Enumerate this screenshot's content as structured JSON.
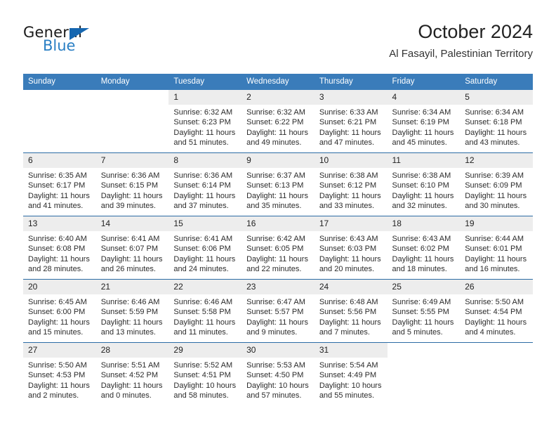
{
  "brand": {
    "name_top": "General",
    "name_bottom": "Blue",
    "triangle_icon": "brand-triangle-icon",
    "accent_color": "#1667b0",
    "blue_text_color": "#2a7fc4"
  },
  "header": {
    "title": "October 2024",
    "subtitle": "Al Fasayil, Palestinian Territory"
  },
  "theme": {
    "header_bg": "#3a7cba",
    "header_text": "#ffffff",
    "daynum_bg": "#ededed",
    "row_divider": "#2c6ca5",
    "cell_bg": "#ffffff",
    "body_text": "#2b2b2b"
  },
  "weekdays": [
    "Sunday",
    "Monday",
    "Tuesday",
    "Wednesday",
    "Thursday",
    "Friday",
    "Saturday"
  ],
  "labels": {
    "sunrise_prefix": "Sunrise:",
    "sunset_prefix": "Sunset:",
    "daylight_prefix": "Daylight:"
  },
  "weeks": [
    [
      {
        "day": "",
        "blank": true,
        "line1": "",
        "line2": "",
        "line3": "",
        "line4": ""
      },
      {
        "day": "",
        "blank": true,
        "line1": "",
        "line2": "",
        "line3": "",
        "line4": ""
      },
      {
        "day": "1",
        "line1": "Sunrise: 6:32 AM",
        "line2": "Sunset: 6:23 PM",
        "line3": "Daylight: 11 hours",
        "line4": "and 51 minutes."
      },
      {
        "day": "2",
        "line1": "Sunrise: 6:32 AM",
        "line2": "Sunset: 6:22 PM",
        "line3": "Daylight: 11 hours",
        "line4": "and 49 minutes."
      },
      {
        "day": "3",
        "line1": "Sunrise: 6:33 AM",
        "line2": "Sunset: 6:21 PM",
        "line3": "Daylight: 11 hours",
        "line4": "and 47 minutes."
      },
      {
        "day": "4",
        "line1": "Sunrise: 6:34 AM",
        "line2": "Sunset: 6:19 PM",
        "line3": "Daylight: 11 hours",
        "line4": "and 45 minutes."
      },
      {
        "day": "5",
        "line1": "Sunrise: 6:34 AM",
        "line2": "Sunset: 6:18 PM",
        "line3": "Daylight: 11 hours",
        "line4": "and 43 minutes."
      }
    ],
    [
      {
        "day": "6",
        "line1": "Sunrise: 6:35 AM",
        "line2": "Sunset: 6:17 PM",
        "line3": "Daylight: 11 hours",
        "line4": "and 41 minutes."
      },
      {
        "day": "7",
        "line1": "Sunrise: 6:36 AM",
        "line2": "Sunset: 6:15 PM",
        "line3": "Daylight: 11 hours",
        "line4": "and 39 minutes."
      },
      {
        "day": "8",
        "line1": "Sunrise: 6:36 AM",
        "line2": "Sunset: 6:14 PM",
        "line3": "Daylight: 11 hours",
        "line4": "and 37 minutes."
      },
      {
        "day": "9",
        "line1": "Sunrise: 6:37 AM",
        "line2": "Sunset: 6:13 PM",
        "line3": "Daylight: 11 hours",
        "line4": "and 35 minutes."
      },
      {
        "day": "10",
        "line1": "Sunrise: 6:38 AM",
        "line2": "Sunset: 6:12 PM",
        "line3": "Daylight: 11 hours",
        "line4": "and 33 minutes."
      },
      {
        "day": "11",
        "line1": "Sunrise: 6:38 AM",
        "line2": "Sunset: 6:10 PM",
        "line3": "Daylight: 11 hours",
        "line4": "and 32 minutes."
      },
      {
        "day": "12",
        "line1": "Sunrise: 6:39 AM",
        "line2": "Sunset: 6:09 PM",
        "line3": "Daylight: 11 hours",
        "line4": "and 30 minutes."
      }
    ],
    [
      {
        "day": "13",
        "line1": "Sunrise: 6:40 AM",
        "line2": "Sunset: 6:08 PM",
        "line3": "Daylight: 11 hours",
        "line4": "and 28 minutes."
      },
      {
        "day": "14",
        "line1": "Sunrise: 6:41 AM",
        "line2": "Sunset: 6:07 PM",
        "line3": "Daylight: 11 hours",
        "line4": "and 26 minutes."
      },
      {
        "day": "15",
        "line1": "Sunrise: 6:41 AM",
        "line2": "Sunset: 6:06 PM",
        "line3": "Daylight: 11 hours",
        "line4": "and 24 minutes."
      },
      {
        "day": "16",
        "line1": "Sunrise: 6:42 AM",
        "line2": "Sunset: 6:05 PM",
        "line3": "Daylight: 11 hours",
        "line4": "and 22 minutes."
      },
      {
        "day": "17",
        "line1": "Sunrise: 6:43 AM",
        "line2": "Sunset: 6:03 PM",
        "line3": "Daylight: 11 hours",
        "line4": "and 20 minutes."
      },
      {
        "day": "18",
        "line1": "Sunrise: 6:43 AM",
        "line2": "Sunset: 6:02 PM",
        "line3": "Daylight: 11 hours",
        "line4": "and 18 minutes."
      },
      {
        "day": "19",
        "line1": "Sunrise: 6:44 AM",
        "line2": "Sunset: 6:01 PM",
        "line3": "Daylight: 11 hours",
        "line4": "and 16 minutes."
      }
    ],
    [
      {
        "day": "20",
        "line1": "Sunrise: 6:45 AM",
        "line2": "Sunset: 6:00 PM",
        "line3": "Daylight: 11 hours",
        "line4": "and 15 minutes."
      },
      {
        "day": "21",
        "line1": "Sunrise: 6:46 AM",
        "line2": "Sunset: 5:59 PM",
        "line3": "Daylight: 11 hours",
        "line4": "and 13 minutes."
      },
      {
        "day": "22",
        "line1": "Sunrise: 6:46 AM",
        "line2": "Sunset: 5:58 PM",
        "line3": "Daylight: 11 hours",
        "line4": "and 11 minutes."
      },
      {
        "day": "23",
        "line1": "Sunrise: 6:47 AM",
        "line2": "Sunset: 5:57 PM",
        "line3": "Daylight: 11 hours",
        "line4": "and 9 minutes."
      },
      {
        "day": "24",
        "line1": "Sunrise: 6:48 AM",
        "line2": "Sunset: 5:56 PM",
        "line3": "Daylight: 11 hours",
        "line4": "and 7 minutes."
      },
      {
        "day": "25",
        "line1": "Sunrise: 6:49 AM",
        "line2": "Sunset: 5:55 PM",
        "line3": "Daylight: 11 hours",
        "line4": "and 5 minutes."
      },
      {
        "day": "26",
        "line1": "Sunrise: 5:50 AM",
        "line2": "Sunset: 4:54 PM",
        "line3": "Daylight: 11 hours",
        "line4": "and 4 minutes."
      }
    ],
    [
      {
        "day": "27",
        "line1": "Sunrise: 5:50 AM",
        "line2": "Sunset: 4:53 PM",
        "line3": "Daylight: 11 hours",
        "line4": "and 2 minutes."
      },
      {
        "day": "28",
        "line1": "Sunrise: 5:51 AM",
        "line2": "Sunset: 4:52 PM",
        "line3": "Daylight: 11 hours",
        "line4": "and 0 minutes."
      },
      {
        "day": "29",
        "line1": "Sunrise: 5:52 AM",
        "line2": "Sunset: 4:51 PM",
        "line3": "Daylight: 10 hours",
        "line4": "and 58 minutes."
      },
      {
        "day": "30",
        "line1": "Sunrise: 5:53 AM",
        "line2": "Sunset: 4:50 PM",
        "line3": "Daylight: 10 hours",
        "line4": "and 57 minutes."
      },
      {
        "day": "31",
        "line1": "Sunrise: 5:54 AM",
        "line2": "Sunset: 4:49 PM",
        "line3": "Daylight: 10 hours",
        "line4": "and 55 minutes."
      },
      {
        "day": "",
        "blank": true,
        "line1": "",
        "line2": "",
        "line3": "",
        "line4": ""
      },
      {
        "day": "",
        "blank": true,
        "line1": "",
        "line2": "",
        "line3": "",
        "line4": ""
      }
    ]
  ]
}
